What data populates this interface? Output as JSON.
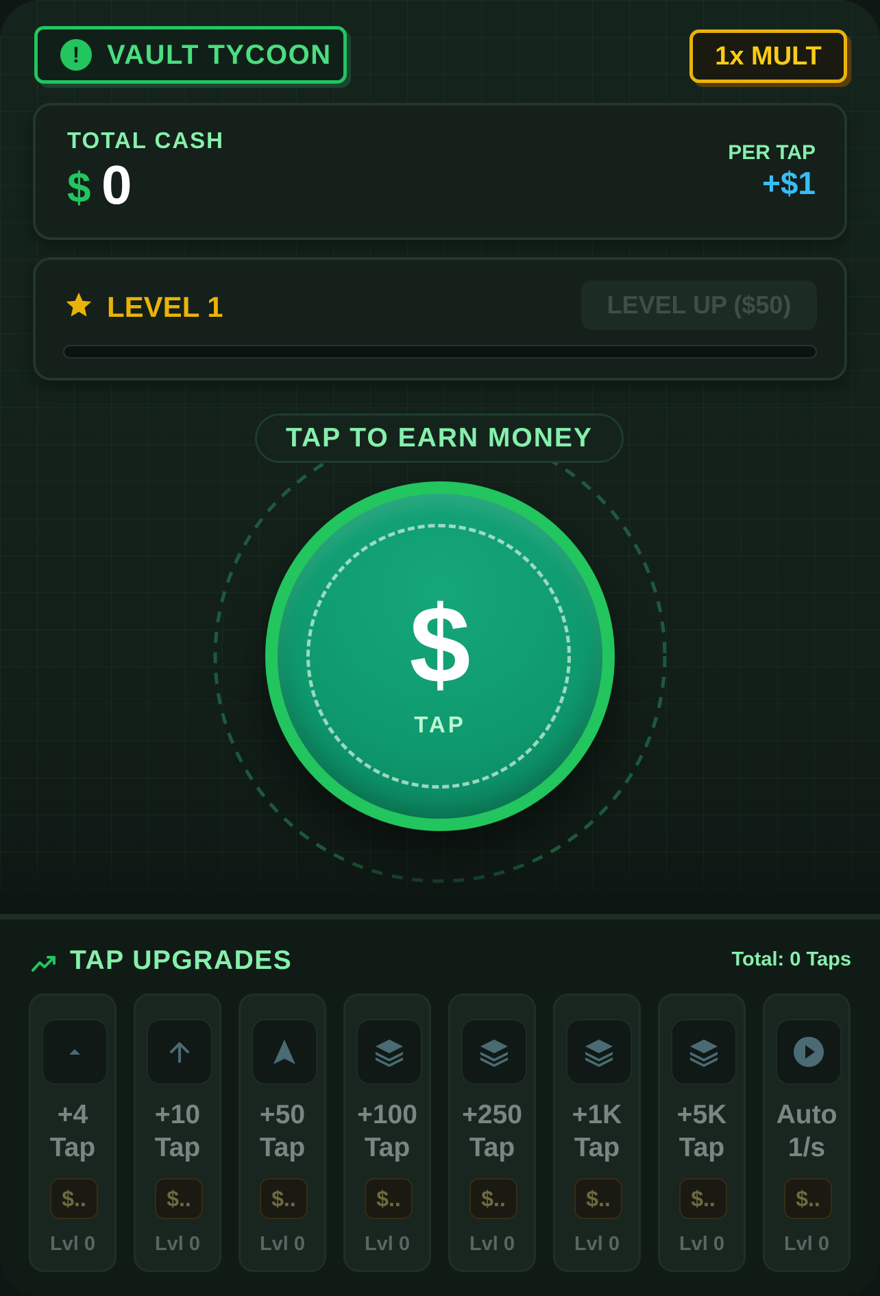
{
  "header": {
    "brand_title": "VAULT TYCOON",
    "brand_icon": "alert-circle-icon",
    "multiplier_label": "1x MULT"
  },
  "cash": {
    "label": "TOTAL CASH",
    "currency": "$",
    "value": "0",
    "per_tap_label": "PER TAP",
    "per_tap_value": "+$1"
  },
  "level": {
    "title": "LEVEL 1",
    "level_up_label": "LEVEL UP ($50)",
    "progress": 0
  },
  "tap": {
    "hint": "TAP TO EARN MONEY",
    "coin_symbol": "$",
    "coin_label": "TAP"
  },
  "upgrades": {
    "title": "TAP UPGRADES",
    "total": "Total: 0 Taps",
    "items": [
      {
        "line1": "+4",
        "line2": "Tap",
        "price": "$..",
        "level": "Lvl 0",
        "icon": "caret-up-icon"
      },
      {
        "line1": "+10",
        "line2": "Tap",
        "price": "$..",
        "level": "Lvl 0",
        "icon": "arrow-up-icon"
      },
      {
        "line1": "+50",
        "line2": "Tap",
        "price": "$..",
        "level": "Lvl 0",
        "icon": "navigation-arrow-icon"
      },
      {
        "line1": "+100",
        "line2": "Tap",
        "price": "$..",
        "level": "Lvl 0",
        "icon": "layers-icon"
      },
      {
        "line1": "+250",
        "line2": "Tap",
        "price": "$..",
        "level": "Lvl 0",
        "icon": "layers-icon"
      },
      {
        "line1": "+1K",
        "line2": "Tap",
        "price": "$..",
        "level": "Lvl 0",
        "icon": "layers-icon"
      },
      {
        "line1": "+5K",
        "line2": "Tap",
        "price": "$..",
        "level": "Lvl 0",
        "icon": "layers-icon"
      },
      {
        "line1": "Auto",
        "line2": "1/s",
        "price": "$..",
        "level": "Lvl 0",
        "icon": "play-circle-icon"
      }
    ]
  },
  "colors": {
    "accent_green": "#22c55e",
    "gold": "#eab308",
    "cyan": "#38bdf8"
  }
}
